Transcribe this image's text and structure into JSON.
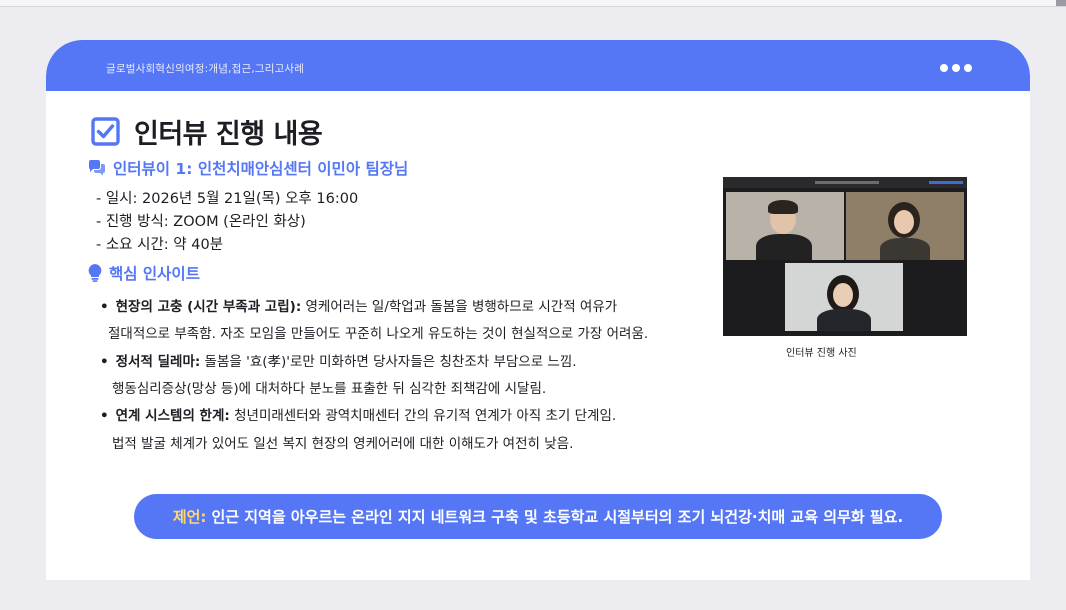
{
  "header": {
    "title": "글로벌사회혁신의여정:개념,접근,그리고사례"
  },
  "page": {
    "title": "인터뷰 진행 내용"
  },
  "interviewee": {
    "heading": "인터뷰이 1: 인천치매안심센터 이민아 팀장님",
    "details": [
      "- 일시: 2026년 5월 21일(목) 오후 16:00",
      "- 진행 방식: ZOOM (온라인 화상)",
      "- 소요 시간: 약 40분"
    ]
  },
  "insights": {
    "heading": "핵심 인사이트",
    "items": [
      {
        "label": "현장의 고충 (시간 부족과 고립):",
        "text": " 영케어러는 일/학업과 돌봄을 병행하므로 시간적 여유가",
        "cont": "절대적으로 부족함. 자조 모임을 만들어도 꾸준히 나오게 유도하는 것이 현실적으로 가장 어려움."
      },
      {
        "label": "정서적 딜레마:",
        "text": " 돌봄을 '효(孝)'로만 미화하면 당사자들은 칭찬조차 부담으로 느낌.",
        "cont": "행동심리증상(망상 등)에 대처하다 분노를 표출한 뒤 심각한 죄책감에 시달림."
      },
      {
        "label": "연계 시스템의 한계:",
        "text": " 청년미래센터와 광역치매센터 간의 유기적 연계가 아직 초기 단계임.",
        "cont": "법적 발굴 체계가 있어도 일선 복지 현장의 영케어러에 대한 이해도가 여전히 낮음."
      }
    ]
  },
  "photo": {
    "caption": "인터뷰 진행 사진"
  },
  "proposal": {
    "label": "제언:",
    "text": "인근 지역을 아우르는 온라인 지지 네트워크 구축 및 초등학교 시절부터의 조기 뇌건강·치매 교육 의무화 필요."
  },
  "colors": {
    "accent": "#5577f5",
    "highlight": "#ffd86a",
    "text": "#1d1d24"
  },
  "icons": [
    "check-square-icon",
    "chat-bubbles-icon",
    "lightbulb-icon",
    "more-dots-icon"
  ]
}
